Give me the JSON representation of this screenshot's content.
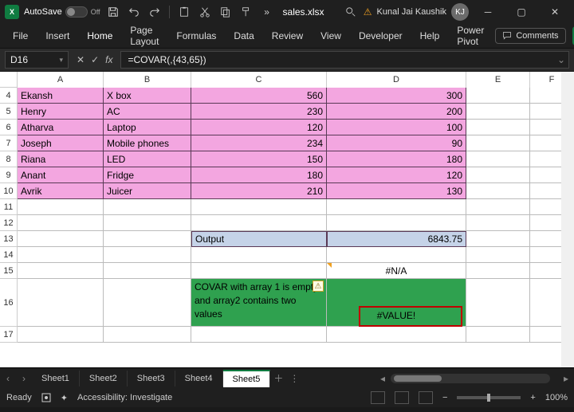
{
  "titlebar": {
    "autosave_label": "AutoSave",
    "autosave_state": "Off",
    "filename": "sales.xlsx",
    "user_name": "Kunal Jai Kaushik",
    "user_initials": "KJ"
  },
  "ribbon": {
    "tabs": [
      "File",
      "Insert",
      "Home",
      "Page Layout",
      "Formulas",
      "Data",
      "Review",
      "View",
      "Developer",
      "Help",
      "Power Pivot"
    ],
    "comments": "Comments"
  },
  "formula_bar": {
    "cell_ref": "D16",
    "formula": "=COVAR(,{43,65})"
  },
  "columns": [
    "A",
    "B",
    "C",
    "D",
    "E",
    "F"
  ],
  "row_numbers": [
    "4",
    "5",
    "6",
    "7",
    "8",
    "9",
    "10",
    "11",
    "12",
    "13",
    "14",
    "15",
    "16",
    "17"
  ],
  "table": [
    {
      "A": "Ekansh",
      "B": "X box",
      "C": "560",
      "D": "300"
    },
    {
      "A": "Henry",
      "B": "AC",
      "C": "230",
      "D": "200"
    },
    {
      "A": "Atharva",
      "B": "Laptop",
      "C": "120",
      "D": "100"
    },
    {
      "A": "Joseph",
      "B": "Mobile phones",
      "C": "234",
      "D": "90"
    },
    {
      "A": "Riana",
      "B": "LED",
      "C": "150",
      "D": "180"
    },
    {
      "A": "Anant",
      "B": "Fridge",
      "C": "180",
      "D": "120"
    },
    {
      "A": "Avrik",
      "B": "Juicer",
      "C": "210",
      "D": "130"
    }
  ],
  "output_row": {
    "label": "Output",
    "value": "6843.75"
  },
  "na_cell": "#N/A",
  "covar_note": "COVAR with array 1 is empty and array2 contains two values",
  "value_err": "#VALUE!",
  "sheets": [
    "Sheet1",
    "Sheet2",
    "Sheet3",
    "Sheet4",
    "Sheet5"
  ],
  "active_sheet": "Sheet5",
  "status": {
    "ready": "Ready",
    "accessibility": "Accessibility: Investigate",
    "zoom": "100%"
  }
}
